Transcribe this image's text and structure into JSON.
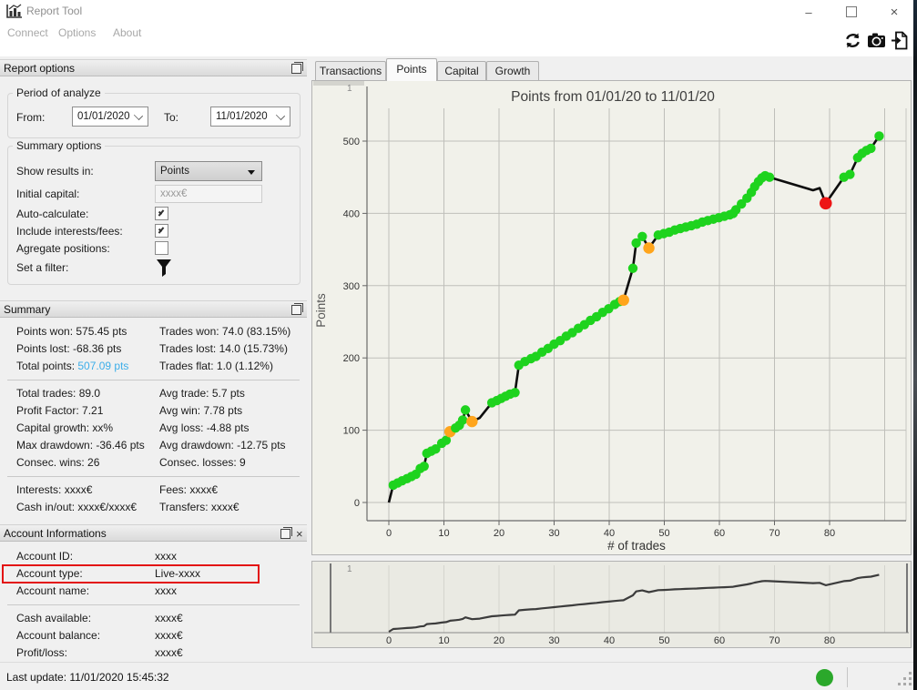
{
  "window": {
    "title": "Report Tool",
    "menu": [
      "Connect",
      "Options",
      "About"
    ],
    "controls": [
      "minimize",
      "maximize",
      "close"
    ]
  },
  "toolbar": {
    "icons": [
      "refresh",
      "screenshot-camera",
      "export-report"
    ]
  },
  "panels": {
    "report_options": {
      "title": "Report options",
      "period_group": {
        "title": "Period of analyze",
        "from_label": "From:",
        "from_value": "01/01/2020",
        "to_label": "To:",
        "to_value": "11/01/2020"
      },
      "summary_group": {
        "title": "Summary options",
        "rows": [
          {
            "label": "Show results in:",
            "control": "combo",
            "value": "Points"
          },
          {
            "label": "Initial capital:",
            "control": "input",
            "value": "xxxx€"
          },
          {
            "label": "Auto-calculate:",
            "control": "checkbox",
            "checked": true
          },
          {
            "label": "Include interests/fees:",
            "control": "checkbox",
            "checked": true
          },
          {
            "label": "Agregate positions:",
            "control": "checkbox",
            "checked": false
          },
          {
            "label": "Set a filter:",
            "control": "filter-icon"
          }
        ]
      }
    },
    "summary": {
      "title": "Summary",
      "rows": [
        {
          "left": "Points won: 575.45 pts",
          "right": "Trades won: 74.0 (83.15%)"
        },
        {
          "left": "Points lost: -68.36 pts",
          "right": "Trades lost: 14.0 (15.73%)"
        },
        {
          "left": "Total points: ",
          "left_accent": "507.09 pts",
          "right": "Trades flat: 1.0 (1.12%)"
        },
        {
          "divider": true
        },
        {
          "left": "Total trades: 89.0",
          "right": "Avg trade: 5.7 pts"
        },
        {
          "left": "Profit Factor: 7.21",
          "right": "Avg win: 7.78 pts"
        },
        {
          "left": "Capital growth: xx%",
          "right": "Avg loss: -4.88 pts"
        },
        {
          "left": "Max drawdown: -36.46 pts",
          "right": "Avg drawdown: -12.75 pts"
        },
        {
          "left": "Consec. wins: 26",
          "right": "Consec. losses: 9"
        },
        {
          "divider": true
        },
        {
          "left": "Interests: xxxx€",
          "right": "Fees: xxxx€"
        },
        {
          "left": "Cash in/out: xxxx€/xxxx€",
          "right": "Transfers: xxxx€"
        }
      ]
    },
    "account": {
      "title": "Account Informations",
      "rows": [
        {
          "label": "Account ID:",
          "value": "xxxx"
        },
        {
          "label": "Account type:",
          "value": "Live-xxxx",
          "highlighted": true
        },
        {
          "label": "Account name:",
          "value": "xxxx"
        },
        {
          "divider": true
        },
        {
          "label": "Cash available:",
          "value": "xxxx€"
        },
        {
          "label": "Account balance:",
          "value": "xxxx€"
        },
        {
          "label": "Profit/loss:",
          "value": "xxxx€"
        }
      ]
    }
  },
  "tabs": [
    {
      "label": "Transactions",
      "active": false
    },
    {
      "label": "Points",
      "active": true
    },
    {
      "label": "Capital",
      "active": false
    },
    {
      "label": "Growth",
      "active": false
    }
  ],
  "status": {
    "last_update": "Last update: 11/01/2020 15:45:32",
    "connection_state": "connected",
    "dot_color": "#2ba82b"
  },
  "chart_data": {
    "type": "line",
    "title": "Points from 01/01/20 to 11/01/20",
    "xlabel": "# of trades",
    "ylabel": "Points",
    "corner_tick": "1",
    "x_ticks": [
      0,
      10,
      20,
      30,
      40,
      50,
      60,
      70,
      80
    ],
    "x_gridline_max": 90,
    "y_ticks": [
      0,
      100,
      200,
      300,
      400,
      500
    ],
    "y_range": [
      -25,
      575
    ],
    "colors": {
      "win": "#1ed31e",
      "flat": "#ffa51c",
      "loss": "#ed1515",
      "line": "#0d0d0d",
      "overview_line": "#3c3c3c"
    },
    "marker_legend": {
      "g": "winning trade",
      "o": "flat/small trade",
      "r": "losing trade",
      "": "no marker"
    },
    "points": [
      [
        0,
        0,
        ""
      ],
      [
        0.8,
        24,
        "g"
      ],
      [
        1.6,
        27,
        "g"
      ],
      [
        2.4,
        30,
        "g"
      ],
      [
        3.3,
        33,
        "g"
      ],
      [
        4.1,
        36,
        "g"
      ],
      [
        4.9,
        39,
        "g"
      ],
      [
        5.7,
        47,
        "g"
      ],
      [
        6.4,
        50,
        "g"
      ],
      [
        6.9,
        68,
        "g"
      ],
      [
        7.7,
        71,
        "g"
      ],
      [
        8.5,
        74,
        "g"
      ],
      [
        9.6,
        82,
        "g"
      ],
      [
        10.4,
        86,
        "g"
      ],
      [
        11.1,
        98,
        "o"
      ],
      [
        12.1,
        103,
        "g"
      ],
      [
        12.8,
        107,
        "g"
      ],
      [
        13.4,
        114,
        "g"
      ],
      [
        13.9,
        128,
        "g"
      ],
      [
        15.1,
        112,
        "o"
      ],
      [
        16.5,
        117,
        ""
      ],
      [
        18.7,
        138,
        "g"
      ],
      [
        19.6,
        141,
        "g"
      ],
      [
        20.4,
        144,
        "g"
      ],
      [
        21.2,
        147,
        "g"
      ],
      [
        22,
        150,
        "g"
      ],
      [
        22.9,
        152,
        "g"
      ],
      [
        23.6,
        190,
        "g"
      ],
      [
        24.7,
        195,
        "g"
      ],
      [
        25.8,
        199,
        "g"
      ],
      [
        26.7,
        202,
        "g"
      ],
      [
        27.8,
        208,
        "g"
      ],
      [
        28.9,
        213,
        "g"
      ],
      [
        30,
        219,
        "g"
      ],
      [
        31.1,
        224,
        "g"
      ],
      [
        32.2,
        230,
        "g"
      ],
      [
        33.3,
        235,
        "g"
      ],
      [
        34.4,
        241,
        "g"
      ],
      [
        35.5,
        246,
        "g"
      ],
      [
        36.6,
        252,
        "g"
      ],
      [
        37.7,
        257,
        "g"
      ],
      [
        38.8,
        263,
        "g"
      ],
      [
        39.9,
        268,
        "g"
      ],
      [
        41,
        274,
        "g"
      ],
      [
        41.9,
        278,
        "g"
      ],
      [
        42.6,
        280,
        "o"
      ],
      [
        44.3,
        324,
        "g"
      ],
      [
        44.9,
        359,
        "g"
      ],
      [
        46,
        368,
        "g"
      ],
      [
        47.2,
        352,
        "o"
      ],
      [
        48.9,
        370,
        "g"
      ],
      [
        49.9,
        372,
        "g"
      ],
      [
        50.9,
        374,
        "g"
      ],
      [
        51.9,
        377,
        "g"
      ],
      [
        52.9,
        379,
        "g"
      ],
      [
        53.9,
        381,
        "g"
      ],
      [
        54.9,
        383,
        "g"
      ],
      [
        55.9,
        385,
        "g"
      ],
      [
        56.9,
        388,
        "g"
      ],
      [
        57.9,
        390,
        "g"
      ],
      [
        58.9,
        392,
        "g"
      ],
      [
        59.9,
        394,
        "g"
      ],
      [
        60.9,
        396,
        "g"
      ],
      [
        61.9,
        398,
        "g"
      ],
      [
        62.5,
        400,
        "g"
      ],
      [
        63,
        405,
        "g"
      ],
      [
        64,
        413,
        "g"
      ],
      [
        65,
        421,
        "g"
      ],
      [
        65.8,
        429,
        "g"
      ],
      [
        66.4,
        437,
        "g"
      ],
      [
        67.1,
        444,
        "g"
      ],
      [
        67.7,
        449,
        "g"
      ],
      [
        68.3,
        452,
        "g"
      ],
      [
        69.1,
        450,
        "g"
      ],
      [
        73,
        441,
        ""
      ],
      [
        77,
        432,
        ""
      ],
      [
        78.2,
        435,
        ""
      ],
      [
        79.3,
        414,
        "r"
      ],
      [
        82.6,
        450,
        "g"
      ],
      [
        83.7,
        454,
        "g"
      ],
      [
        85.1,
        477,
        "g"
      ],
      [
        85.9,
        483,
        "g"
      ],
      [
        86.7,
        487,
        "g"
      ],
      [
        87.5,
        490,
        "g"
      ],
      [
        89,
        507,
        "g"
      ]
    ],
    "overview": {
      "present": true,
      "corner_tick": "1"
    }
  }
}
